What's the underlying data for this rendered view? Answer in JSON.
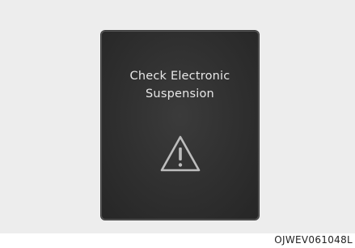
{
  "display": {
    "message_line1": "Check Electronic",
    "message_line2": "Suspension",
    "icon": "warning-triangle-icon",
    "colors": {
      "panel_background": "#2f2f2f",
      "text": "#e8e8e8",
      "icon_stroke": "#bdbdbd",
      "frame_background": "#ededed"
    }
  },
  "figure": {
    "code": "OJWEV061048L"
  }
}
